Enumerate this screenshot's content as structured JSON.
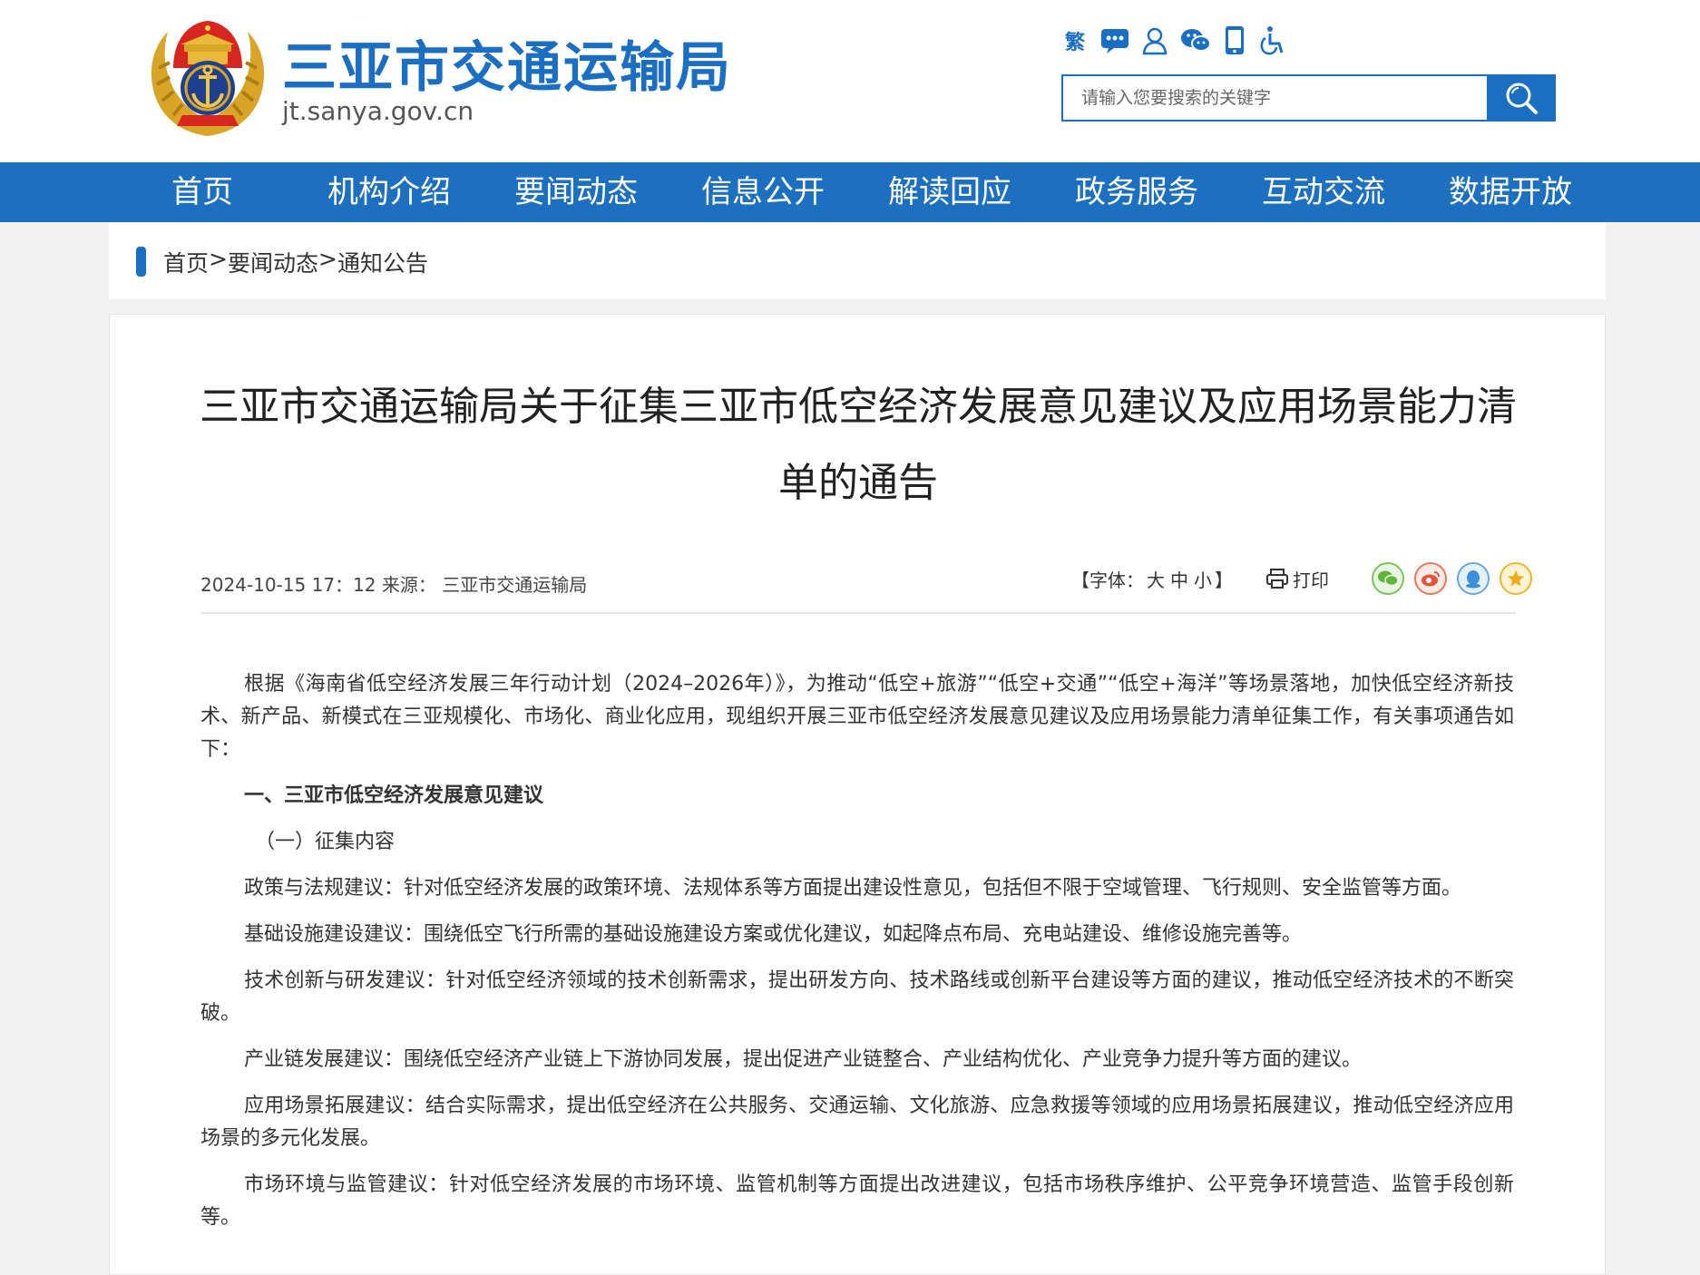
{
  "header": {
    "site_title": "三亚市交通运输局",
    "site_domain": "jt.sanya.gov.cn",
    "tools": {
      "traditional_label": "繁",
      "icons": [
        "message-icon",
        "user-icon",
        "wechat-icon",
        "mobile-icon",
        "accessibility-icon"
      ]
    },
    "search": {
      "placeholder": "请输入您要搜索的关键字",
      "icon": "search-icon"
    }
  },
  "nav": {
    "items": [
      {
        "label": "首页"
      },
      {
        "label": "机构介绍"
      },
      {
        "label": "要闻动态"
      },
      {
        "label": "信息公开"
      },
      {
        "label": "解读回应"
      },
      {
        "label": "政务服务"
      },
      {
        "label": "互动交流"
      },
      {
        "label": "数据开放"
      }
    ]
  },
  "breadcrumb": {
    "items": [
      "首页",
      "要闻动态",
      "通知公告"
    ],
    "separator": ">"
  },
  "article": {
    "title": "三亚市交通运输局关于征集三亚市低空经济发展意见建议及应用场景能力清单的通告",
    "meta": {
      "date": "2024-10-15 17：12",
      "source_label": "来源：",
      "source": "三亚市交通运输局",
      "font_label_prefix": "【字体：",
      "font_large": "大",
      "font_medium": "中",
      "font_small": "小",
      "font_label_suffix": "】",
      "print_label": "打印",
      "share_icons": [
        "wechat-share-icon",
        "weibo-share-icon",
        "qq-share-icon",
        "qzone-share-icon"
      ]
    },
    "paragraphs": {
      "intro": "根据《海南省低空经济发展三年行动计划（2024–2026年）》，为推动“低空+旅游”“低空+交通”“低空+海洋”等场景落地，加快低空经济新技术、新产品、新模式在三亚规模化、市场化、商业化应用，现组织开展三亚市低空经济发展意见建议及应用场景能力清单征集工作，有关事项通告如下：",
      "section1": "一、三亚市低空经济发展意见建议",
      "sub1": "（一）征集内容",
      "p1": "政策与法规建议：针对低空经济发展的政策环境、法规体系等方面提出建设性意见，包括但不限于空域管理、飞行规则、安全监管等方面。",
      "p2": "基础设施建设建议：围绕低空飞行所需的基础设施建设方案或优化建议，如起降点布局、充电站建设、维修设施完善等。",
      "p3": "技术创新与研发建议：针对低空经济领域的技术创新需求，提出研发方向、技术路线或创新平台建设等方面的建议，推动低空经济技术的不断突破。",
      "p4": "产业链发展建议：围绕低空经济产业链上下游协同发展，提出促进产业链整合、产业结构优化、产业竞争力提升等方面的建议。",
      "p5": "应用场景拓展建议：结合实际需求，提出低空经济在公共服务、交通运输、文化旅游、应急救援等领域的应用场景拓展建议，推动低空经济应用场景的多元化发展。",
      "p6": "市场环境与监管建议：针对低空经济发展的市场环境、监管机制等方面提出改进建议，包括市场秩序维护、公平竞争环境营造、监管手段创新等。"
    }
  },
  "colors": {
    "brand_blue": "#1a6fc3",
    "nav_blue": "#1d6fbf",
    "emblem_red": "#d7261e",
    "emblem_gold": "#d9a528",
    "emblem_navy": "#1f3f8f"
  }
}
